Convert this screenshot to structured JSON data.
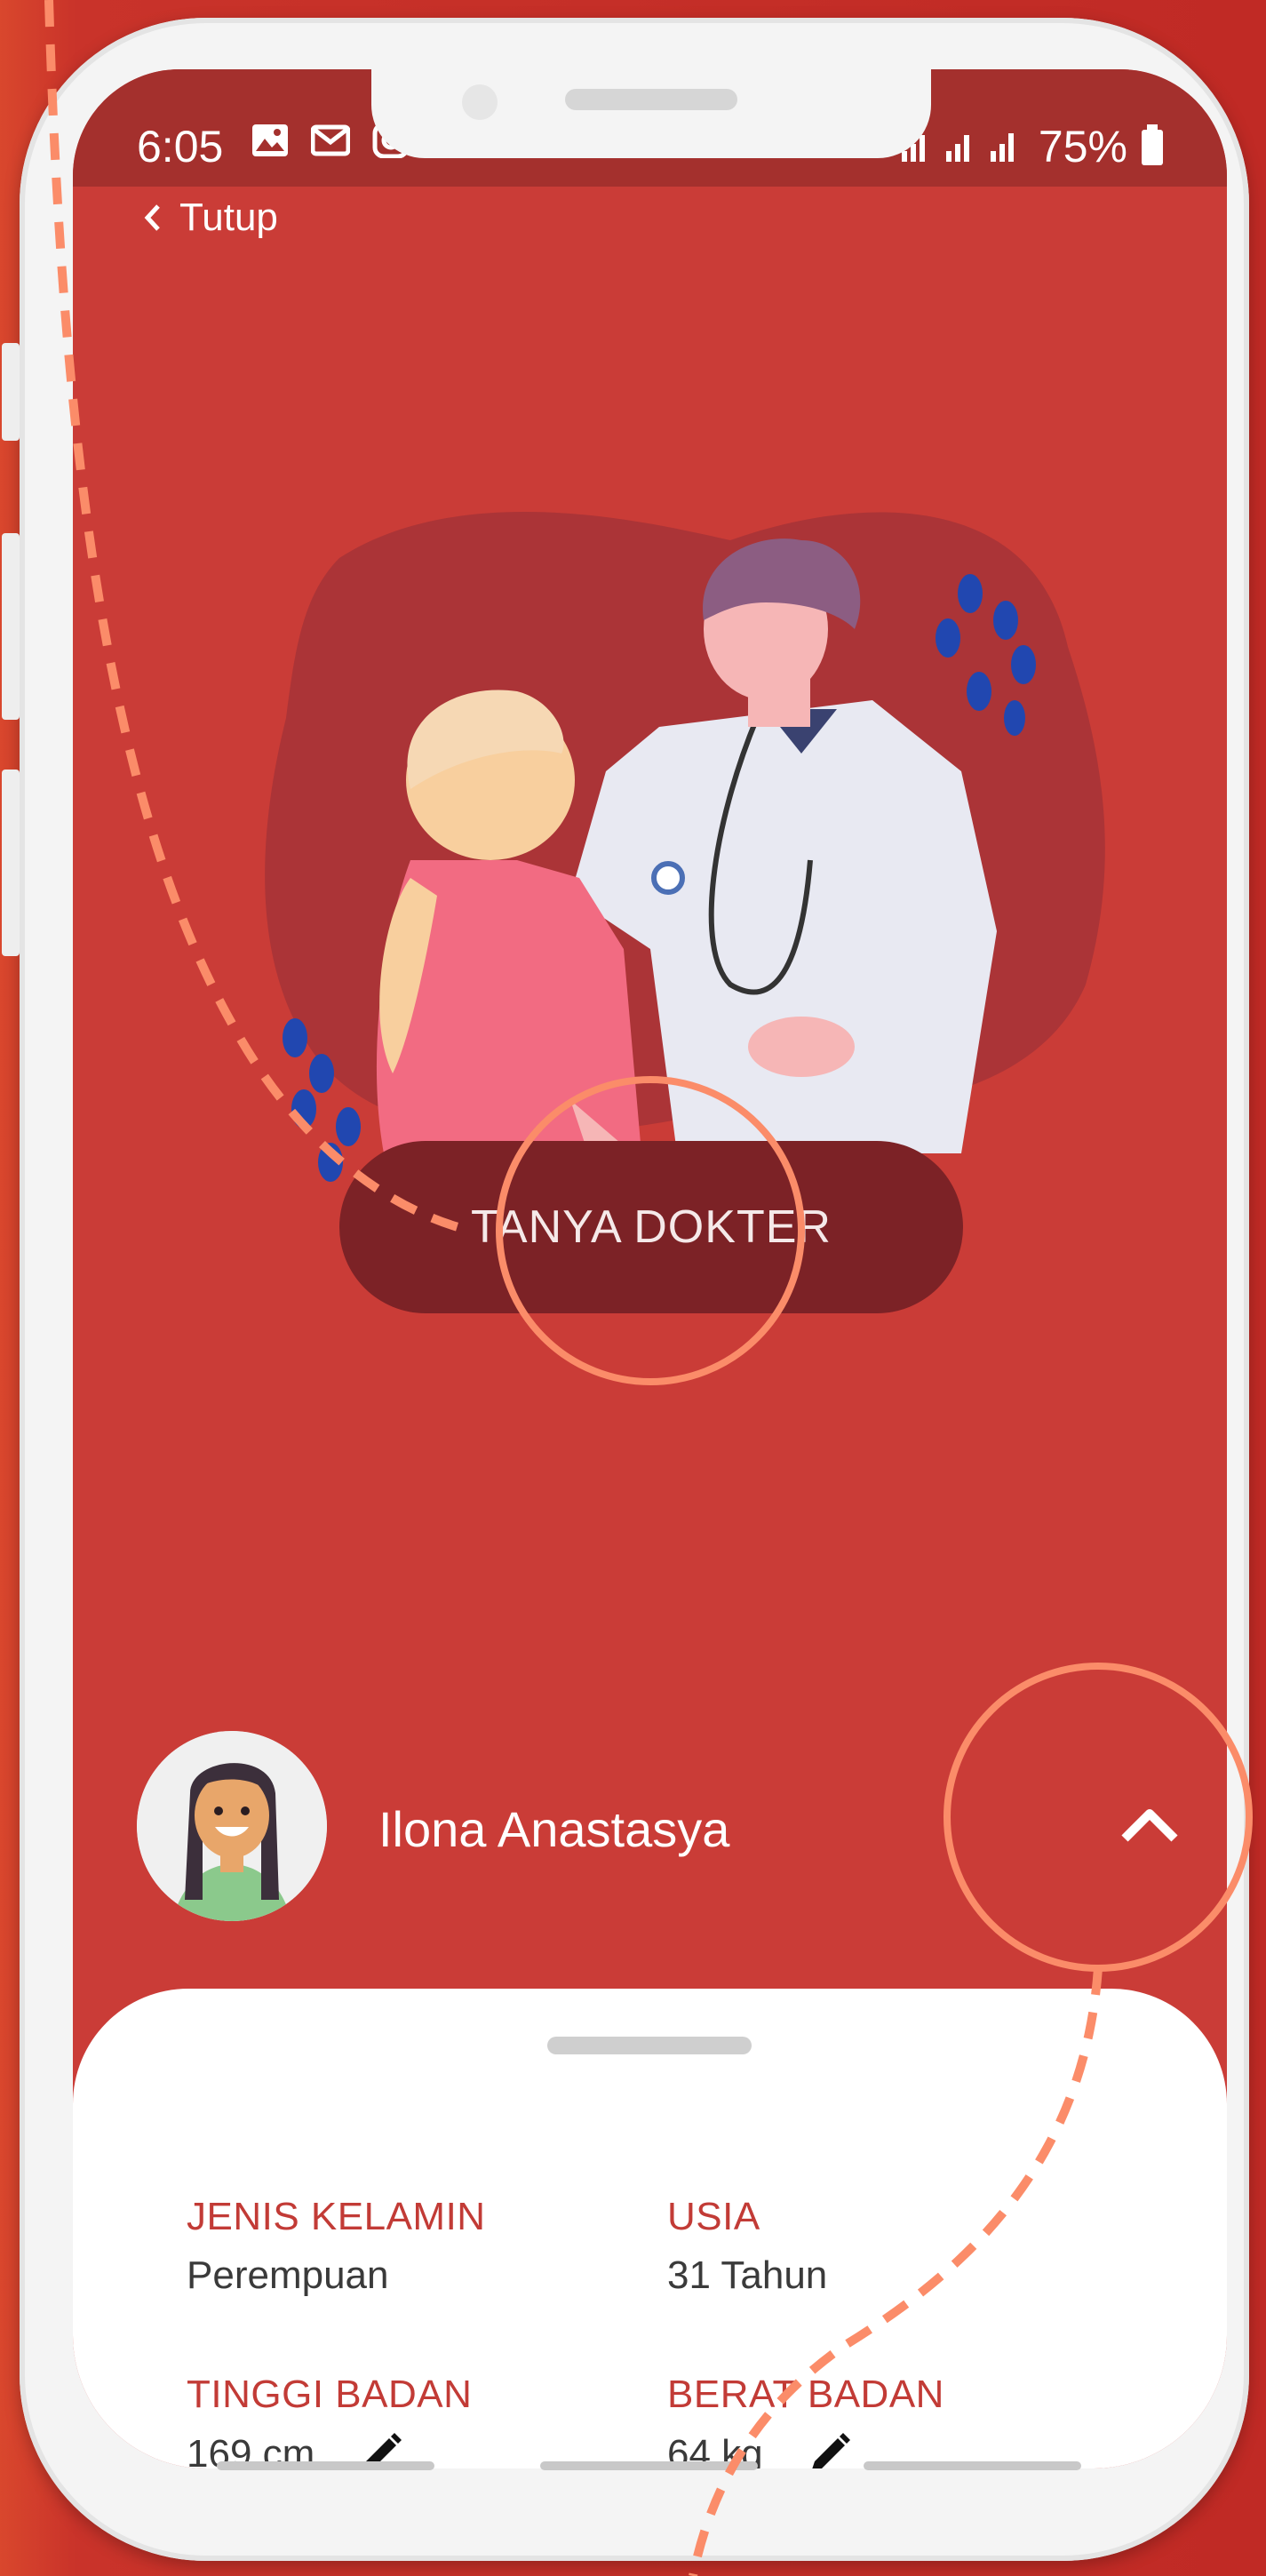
{
  "statusbar": {
    "time": "6:05",
    "battery": "75%"
  },
  "header": {
    "back_label": "Tutup"
  },
  "main": {
    "ask_button_label": "TANYA DOKTER"
  },
  "profile": {
    "name": "Ilona Anastasya"
  },
  "sheet": {
    "fields": [
      {
        "label": "JENIS KELAMIN",
        "value": "Perempuan"
      },
      {
        "label": "USIA",
        "value": "31 Tahun"
      },
      {
        "label": "TINGGI BADAN",
        "value": "169 cm"
      },
      {
        "label": "BERAT BADAN",
        "value": "64 kg"
      }
    ]
  },
  "colors": {
    "background": "#c02a25",
    "screen": "#ca3c37",
    "statusbar": "#a4302d",
    "button": "#7c2226",
    "label": "#c23b36",
    "annotation": "#fb8c69"
  },
  "icons": [
    "image-icon",
    "gmail-icon",
    "instagram-icon",
    "signal-icon",
    "battery-icon",
    "back-chevron-icon",
    "chevron-up-icon",
    "pencil-icon"
  ]
}
